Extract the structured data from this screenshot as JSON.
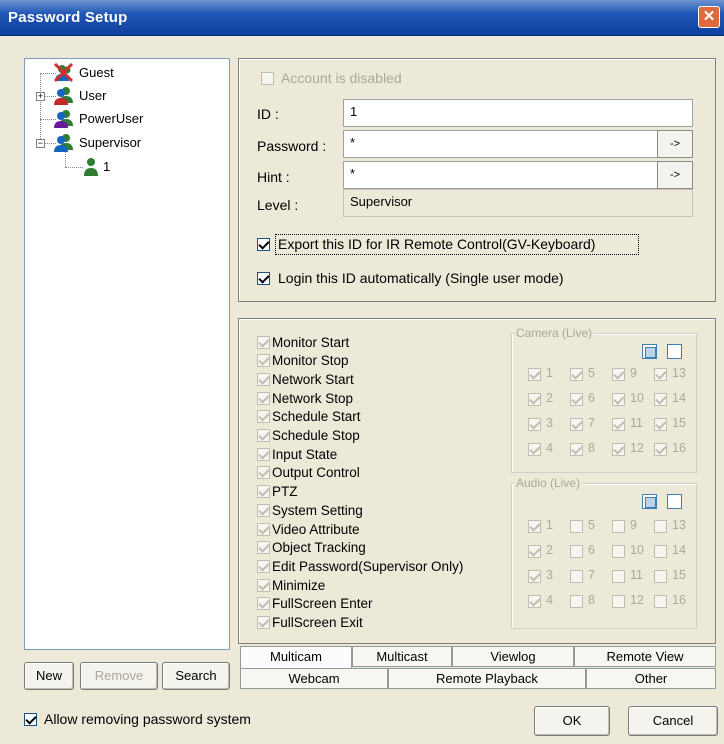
{
  "window": {
    "title": "Password Setup",
    "close_glyph": "✕"
  },
  "tree": {
    "items": [
      {
        "label": "Guest",
        "icon": "guest-disabled-icon"
      },
      {
        "label": "User",
        "icon": "user-group-icon"
      },
      {
        "label": "PowerUser",
        "icon": "poweruser-group-icon"
      },
      {
        "label": "Supervisor",
        "icon": "supervisor-group-icon"
      },
      {
        "label": "1",
        "icon": "user-icon"
      }
    ],
    "expander_plus": "+",
    "expander_minus": "−"
  },
  "tree_buttons": {
    "new": "New",
    "remove": "Remove",
    "search": "Search"
  },
  "account": {
    "disabled_label": "Account is disabled",
    "id_label": "ID :",
    "id_value": "1",
    "password_label": "Password :",
    "password_value": "*",
    "hint_label": "Hint :",
    "hint_value": "*",
    "level_label": "Level :",
    "level_value": "Supervisor",
    "arrow": "->",
    "export_label": "Export this ID for IR Remote Control(GV-Keyboard)",
    "autologin_label": "Login this ID automatically (Single user mode)"
  },
  "permissions": [
    "Monitor Start",
    "Monitor Stop",
    "Network Start",
    "Network Stop",
    "Schedule Start",
    "Schedule Stop",
    "Input State",
    "Output Control",
    "PTZ",
    "System Setting",
    "Video Attribute",
    "Object Tracking",
    "Edit Password(Supervisor Only)",
    "Minimize",
    "FullScreen Enter",
    "FullScreen Exit"
  ],
  "camera_group": {
    "title": "Camera (Live)",
    "rows": [
      [
        "1",
        "5",
        "9",
        "13"
      ],
      [
        "2",
        "6",
        "10",
        "14"
      ],
      [
        "3",
        "7",
        "11",
        "15"
      ],
      [
        "4",
        "8",
        "12",
        "16"
      ]
    ]
  },
  "audio_group": {
    "title": "Audio (Live)",
    "rows": [
      [
        "1",
        "5",
        "9",
        "13"
      ],
      [
        "2",
        "6",
        "10",
        "14"
      ],
      [
        "3",
        "7",
        "11",
        "15"
      ],
      [
        "4",
        "8",
        "12",
        "16"
      ]
    ]
  },
  "tabs_top": [
    "Multicam",
    "Multicast",
    "Viewlog",
    "Remote View"
  ],
  "tabs_bottom": [
    "Webcam",
    "Remote Playback",
    "Other"
  ],
  "footer": {
    "allow_label": "Allow removing password system",
    "ok": "OK",
    "cancel": "Cancel"
  }
}
